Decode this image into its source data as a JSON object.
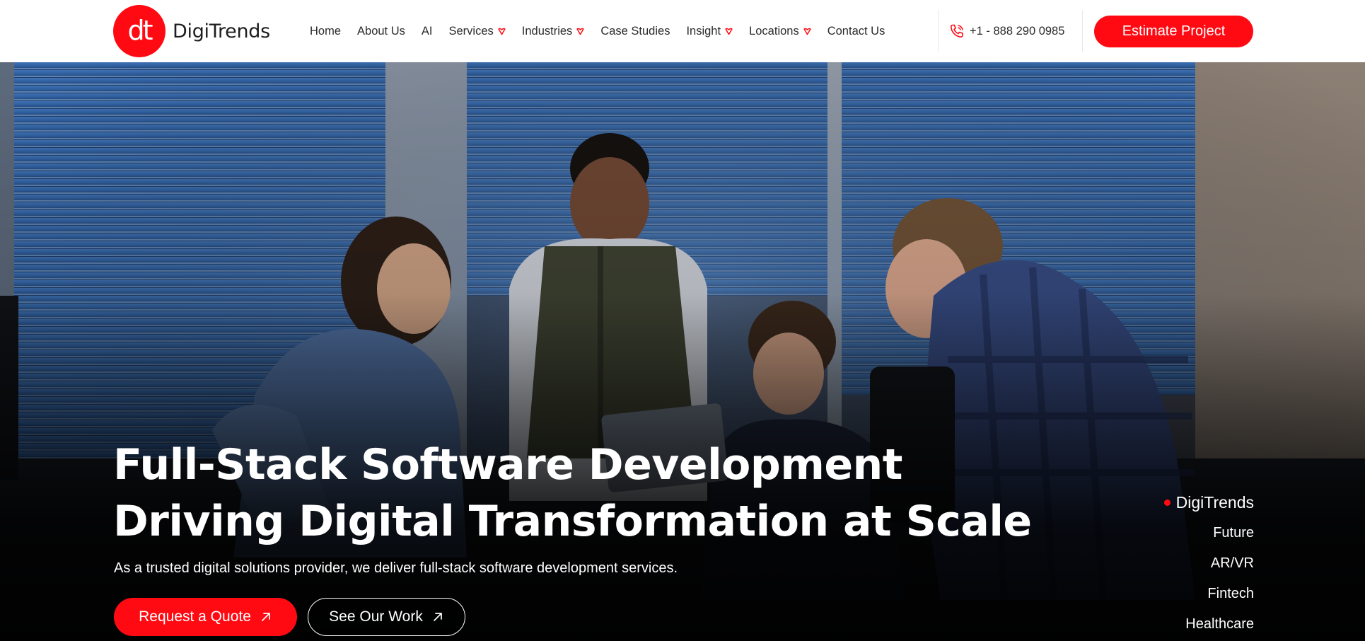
{
  "brand": {
    "name": "DigiTrends",
    "logo_mark": "dt",
    "accent_color": "#ff0a12"
  },
  "nav": {
    "items": [
      {
        "label": "Home",
        "has_dropdown": false
      },
      {
        "label": "About Us",
        "has_dropdown": false
      },
      {
        "label": "AI",
        "has_dropdown": false
      },
      {
        "label": "Services",
        "has_dropdown": true
      },
      {
        "label": "Industries",
        "has_dropdown": true
      },
      {
        "label": "Case Studies",
        "has_dropdown": false
      },
      {
        "label": "Insight",
        "has_dropdown": true
      },
      {
        "label": "Locations",
        "has_dropdown": true
      },
      {
        "label": "Contact Us",
        "has_dropdown": false
      }
    ],
    "dropdown_icon": "heart-chevron-icon"
  },
  "contact": {
    "phone": "+1 - 888 290 0985",
    "phone_icon": "phone-icon"
  },
  "header": {
    "estimate_label": "Estimate Project"
  },
  "hero": {
    "title_line1": "Full-Stack Software Development",
    "title_line2": "Driving Digital Transformation at Scale",
    "subtitle": "As a trusted digital solutions provider, we deliver full-stack software development services.",
    "primary_cta": "Request a Quote",
    "secondary_cta": "See Our Work",
    "cta_icon": "arrow-up-right-icon"
  },
  "side_list": {
    "items": [
      "DigiTrends",
      "Future",
      "AR/VR",
      "Fintech",
      "Healthcare"
    ],
    "active_index": 0
  }
}
